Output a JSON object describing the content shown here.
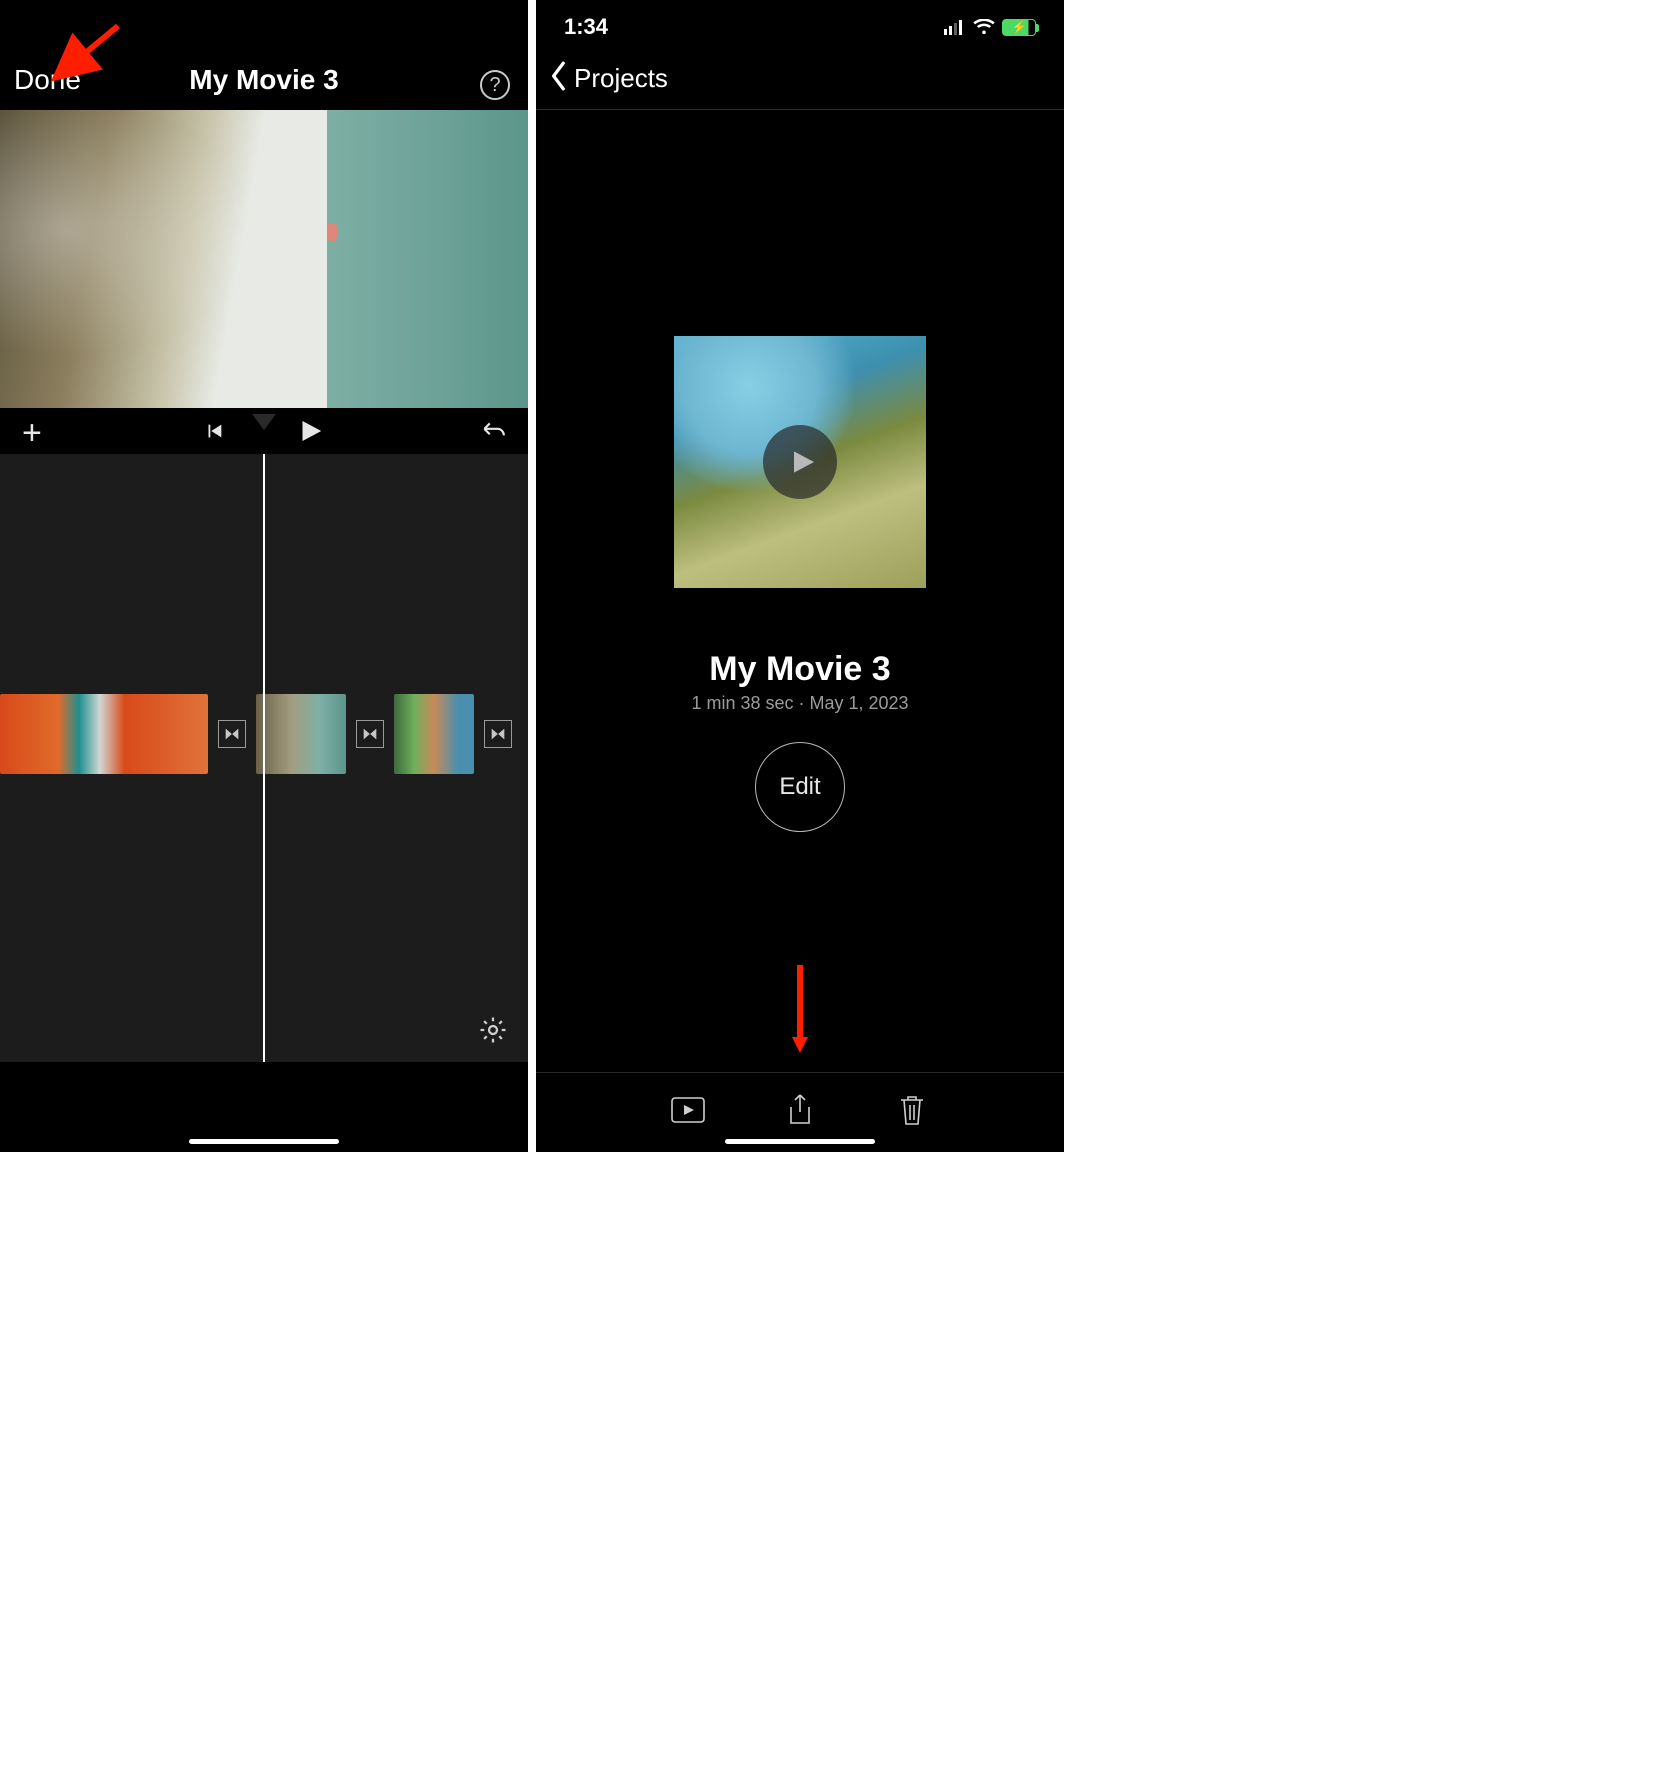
{
  "left": {
    "done_label": "Done",
    "title": "My Movie 3",
    "help_label": "?",
    "add_label": "+"
  },
  "right": {
    "status_time": "1:34",
    "back_label": "Projects",
    "project_title": "My Movie 3",
    "project_sub": "1 min 38 sec · May 1, 2023",
    "edit_label": "Edit"
  }
}
